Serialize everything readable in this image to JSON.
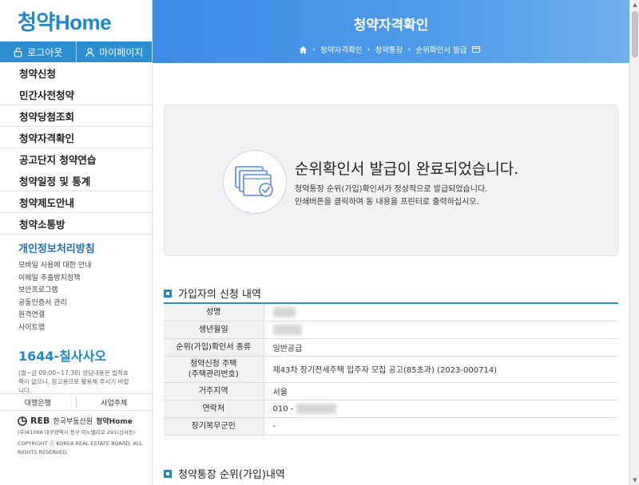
{
  "brand": {
    "logo": "청약Home"
  },
  "top_buttons": {
    "logout": "로그아웃",
    "mypage": "마이페이지"
  },
  "menu": [
    "청약신청",
    "민간사전청약",
    "청약당첨조회",
    "청약자격확인",
    "공고단지 청약연습",
    "청약일정 및 통계",
    "청약제도안내",
    "청약소통방"
  ],
  "privacy": {
    "title": "개인정보처리방침",
    "links": [
      "모바일 사용에 대한 안내",
      "이메일 추출방지정책",
      "보안프로그램",
      "공동인증서 관리",
      "원격연결",
      "사이트맵"
    ]
  },
  "phone": {
    "number": "1644-칠사사오",
    "hours": "(월~금 09:00~17:30) 상담내용은 법적효력이 없으니, 참고용으로 활용해 주시기 바랍니다."
  },
  "banks": {
    "left": "대행은행",
    "right": "사업주체"
  },
  "footer": {
    "reb": "REB",
    "org": "한국부동산원",
    "brand": "청약Home",
    "address": "(우)41068 대구광역시 동구 이노밸리로 291(신서동)",
    "copyright": "COPYRIGHT ⓒ KOREA REAL ESTATE BOARD. ALL RIGHTS RESERVED."
  },
  "header": {
    "title": "청약자격확인",
    "breadcrumb": [
      "청약자격확인",
      "청약통장",
      "순위확인서 발급"
    ]
  },
  "done": {
    "title": "순위확인서 발급이 완료되었습니다.",
    "line1": "청약통장 순위(가입)확인서가 정상적으로 발급되었습니다.",
    "line2": "인쇄버튼을 클릭하여 동 내용을 프린터로 출력하십시오."
  },
  "section1": {
    "title": "가입자의 신청 내역"
  },
  "rows": [
    {
      "label": "성명",
      "value": ""
    },
    {
      "label": "생년월일",
      "value": ""
    },
    {
      "label": "순위(가입)확인서 종류",
      "value": "일반공급"
    },
    {
      "label": "청약신청 주택\n(주택관리번호)",
      "value": "제43차 장기전세주택 입주자 모집 공고(85초과) (2023-000714)"
    },
    {
      "label": "거주지역",
      "value": "서울"
    },
    {
      "label": "연락처",
      "value": "010 -"
    },
    {
      "label": "장기복무군인",
      "value": "-"
    }
  ],
  "section2": {
    "title": "청약통장 순위(가입)내역"
  }
}
